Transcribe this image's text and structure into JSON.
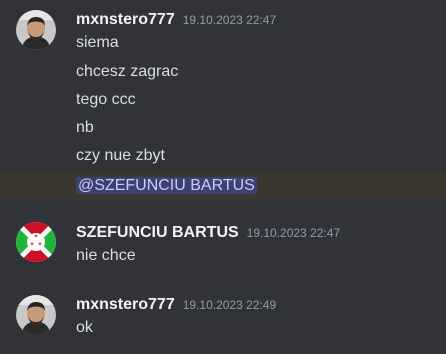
{
  "messages": [
    {
      "username": "mxnstero777",
      "timestamp": "19.10.2023 22:47",
      "avatar": "person-avatar",
      "lines": [
        "siema",
        "chcesz zagrac",
        "tego ccc",
        "nb",
        "czy nue zbyt"
      ],
      "mention": "@SZEFUNCIU BARTUS"
    },
    {
      "username": "SZEFUNCIU BARTUS",
      "timestamp": "19.10.2023 22:47",
      "avatar": "burundi-flag-avatar",
      "lines": [
        "nie chce"
      ]
    },
    {
      "username": "mxnstero777",
      "timestamp": "19.10.2023 22:49",
      "avatar": "person-avatar",
      "lines": [
        "ok"
      ]
    }
  ],
  "colors": {
    "background": "#313338",
    "highlight": "#3a3630",
    "mention_bg": "#3c4270",
    "mention_fg": "#c9cdfb",
    "username": "#f2f3f5",
    "text": "#dbdee1",
    "timestamp": "#949ba4"
  }
}
